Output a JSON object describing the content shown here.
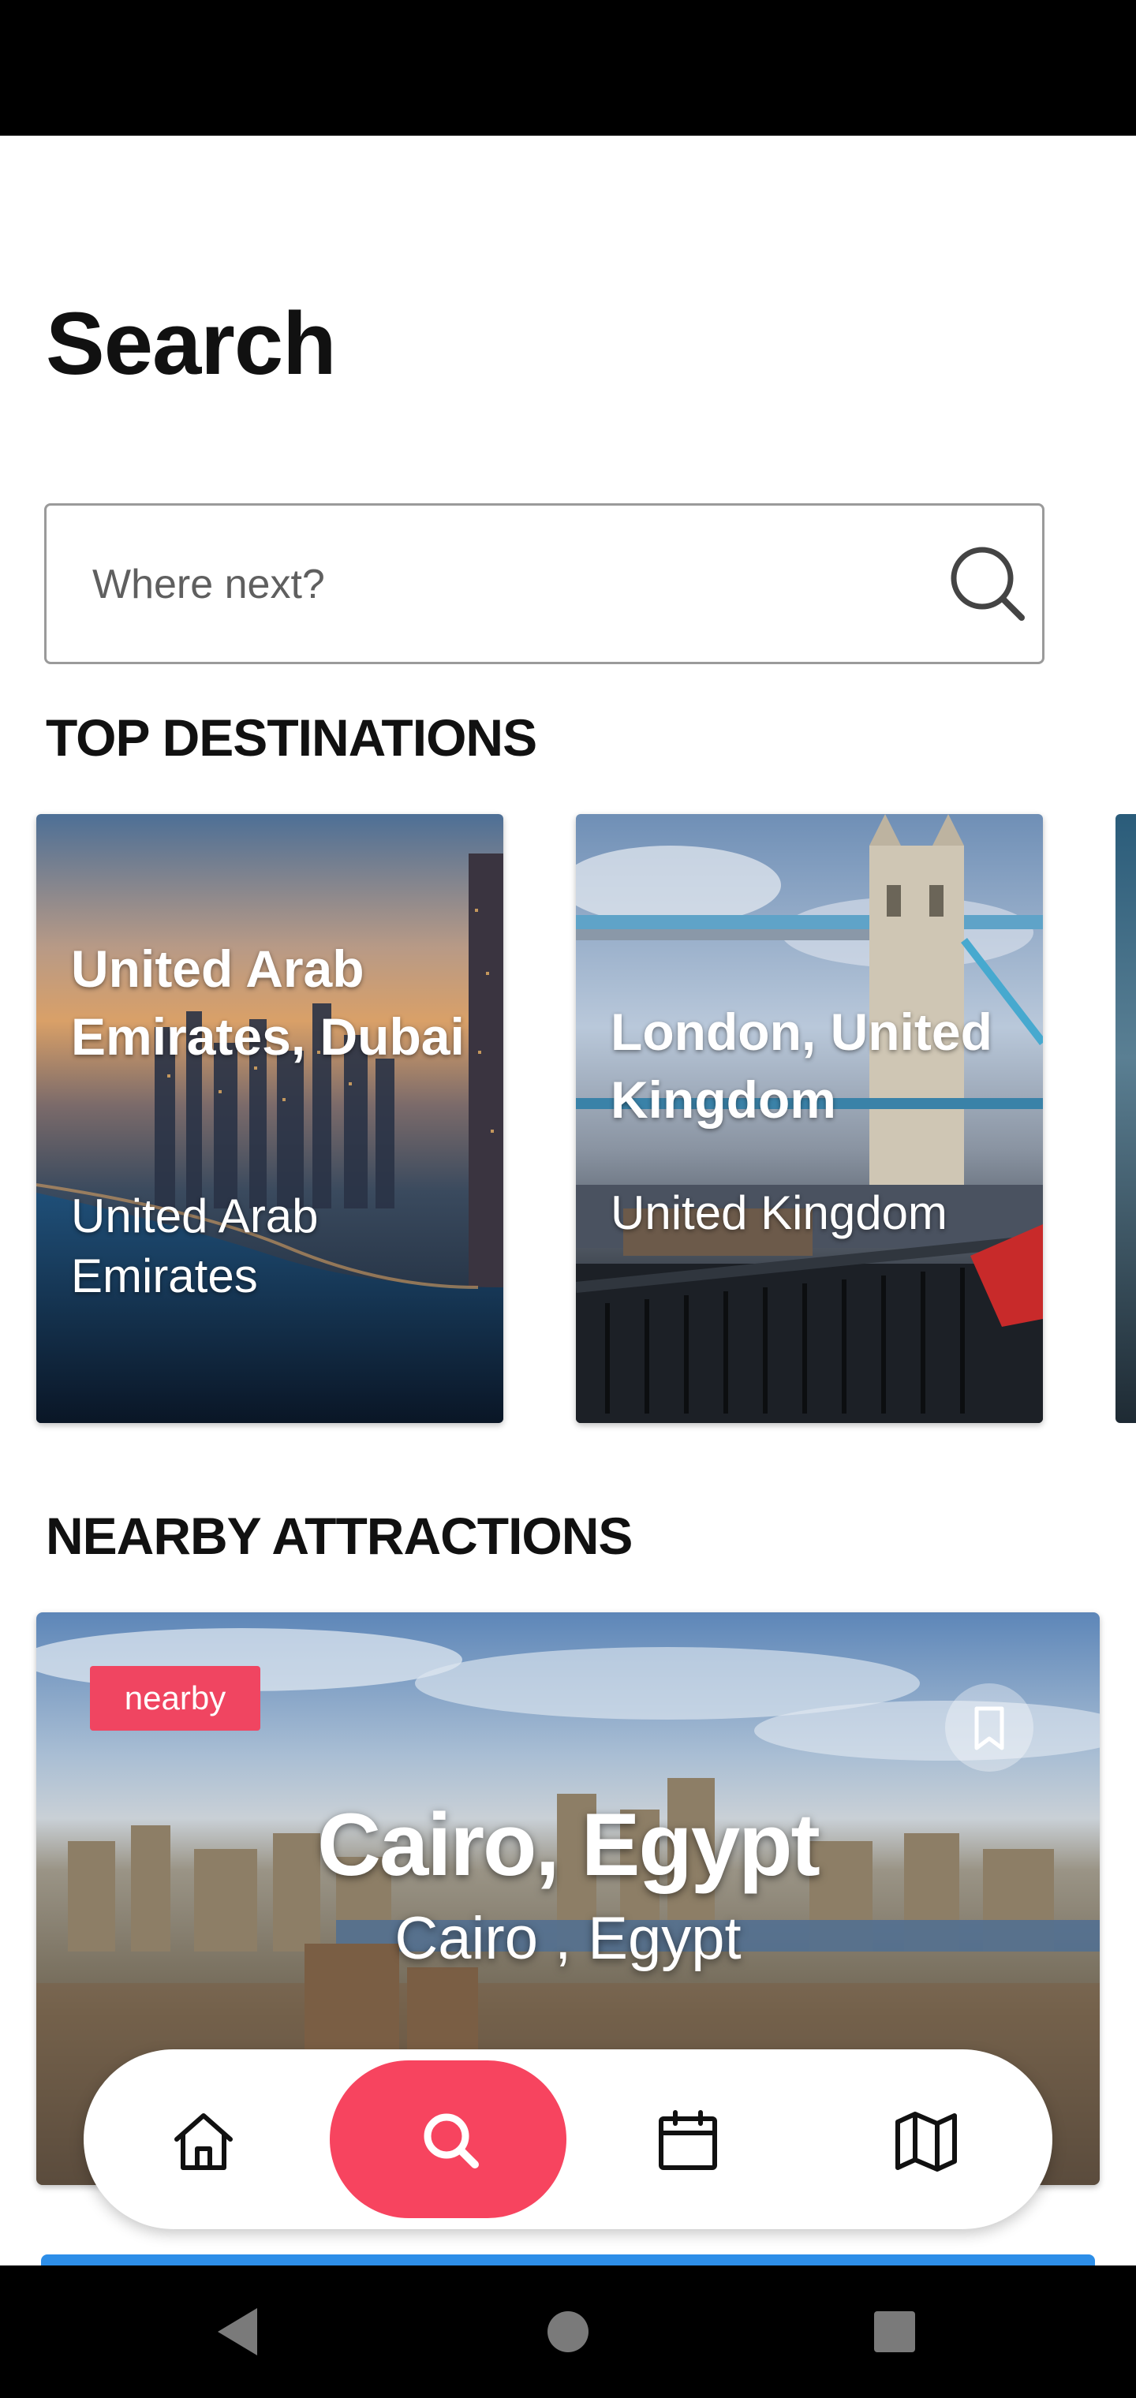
{
  "page": {
    "title": "Search"
  },
  "search": {
    "placeholder": "Where next?",
    "value": ""
  },
  "sections": {
    "top_destinations": "TOP DESTINATIONS",
    "nearby_attractions": "NEARBY ATTRACTIONS"
  },
  "destinations": [
    {
      "title": "United Arab Emirates, Dubai",
      "country": "United Arab Emirates"
    },
    {
      "title": "London, United Kingdom",
      "country": "United Kingdom"
    }
  ],
  "attraction": {
    "badge": "nearby",
    "title": "Cairo, Egypt",
    "subtitle": "Cairo , Egypt"
  },
  "bottom_nav": {
    "items": [
      {
        "icon": "home-icon",
        "active": false
      },
      {
        "icon": "search-icon",
        "active": true
      },
      {
        "icon": "calendar-icon",
        "active": false
      },
      {
        "icon": "map-icon",
        "active": false
      }
    ]
  },
  "colors": {
    "accent": "#f7445f",
    "badge": "#f04561",
    "next_card": "#2d8ee8"
  }
}
